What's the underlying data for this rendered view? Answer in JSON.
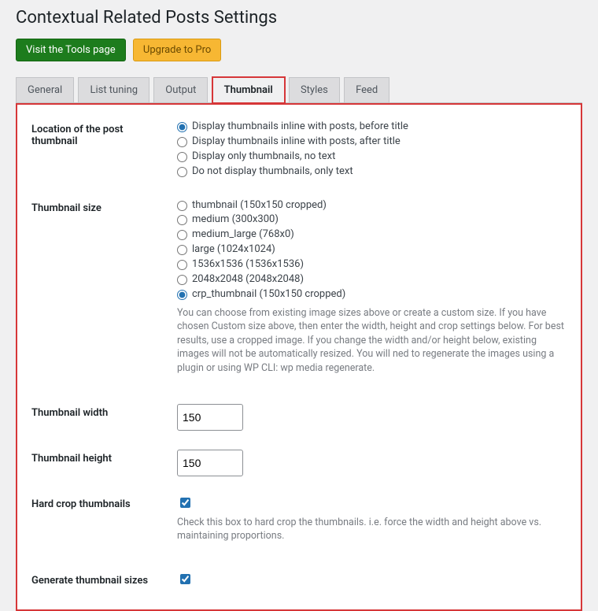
{
  "title": "Contextual Related Posts Settings",
  "buttons": {
    "tools": "Visit the Tools page",
    "upgrade": "Upgrade to Pro"
  },
  "tabs": [
    "General",
    "List tuning",
    "Output",
    "Thumbnail",
    "Styles",
    "Feed"
  ],
  "active_tab": "Thumbnail",
  "fields": {
    "location": {
      "label": "Location of the post thumbnail",
      "opts": [
        "Display thumbnails inline with posts, before title",
        "Display thumbnails inline with posts, after title",
        "Display only thumbnails, no text",
        "Do not display thumbnails, only text"
      ],
      "selected": 0
    },
    "size": {
      "label": "Thumbnail size",
      "opts": [
        "thumbnail (150x150 cropped)",
        "medium (300x300)",
        "medium_large (768x0)",
        "large (1024x1024)",
        "1536x1536 (1536x1536)",
        "2048x2048 (2048x2048)",
        "crp_thumbnail (150x150 cropped)"
      ],
      "selected": 6,
      "desc": "You can choose from existing image sizes above or create a custom size. If you have chosen Custom size above, then enter the width, height and crop settings below. For best results, use a cropped image. If you change the width and/or height below, existing images will not be automatically resized. You will ned to regenerate the images using a plugin or using WP CLI: wp media regenerate."
    },
    "width": {
      "label": "Thumbnail width",
      "value": "150"
    },
    "height": {
      "label": "Thumbnail height",
      "value": "150"
    },
    "hardcrop": {
      "label": "Hard crop thumbnails",
      "checked": true,
      "desc": "Check this box to hard crop the thumbnails. i.e. force the width and height above vs. maintaining proportions."
    },
    "generate": {
      "label": "Generate thumbnail sizes",
      "checked": true
    }
  }
}
